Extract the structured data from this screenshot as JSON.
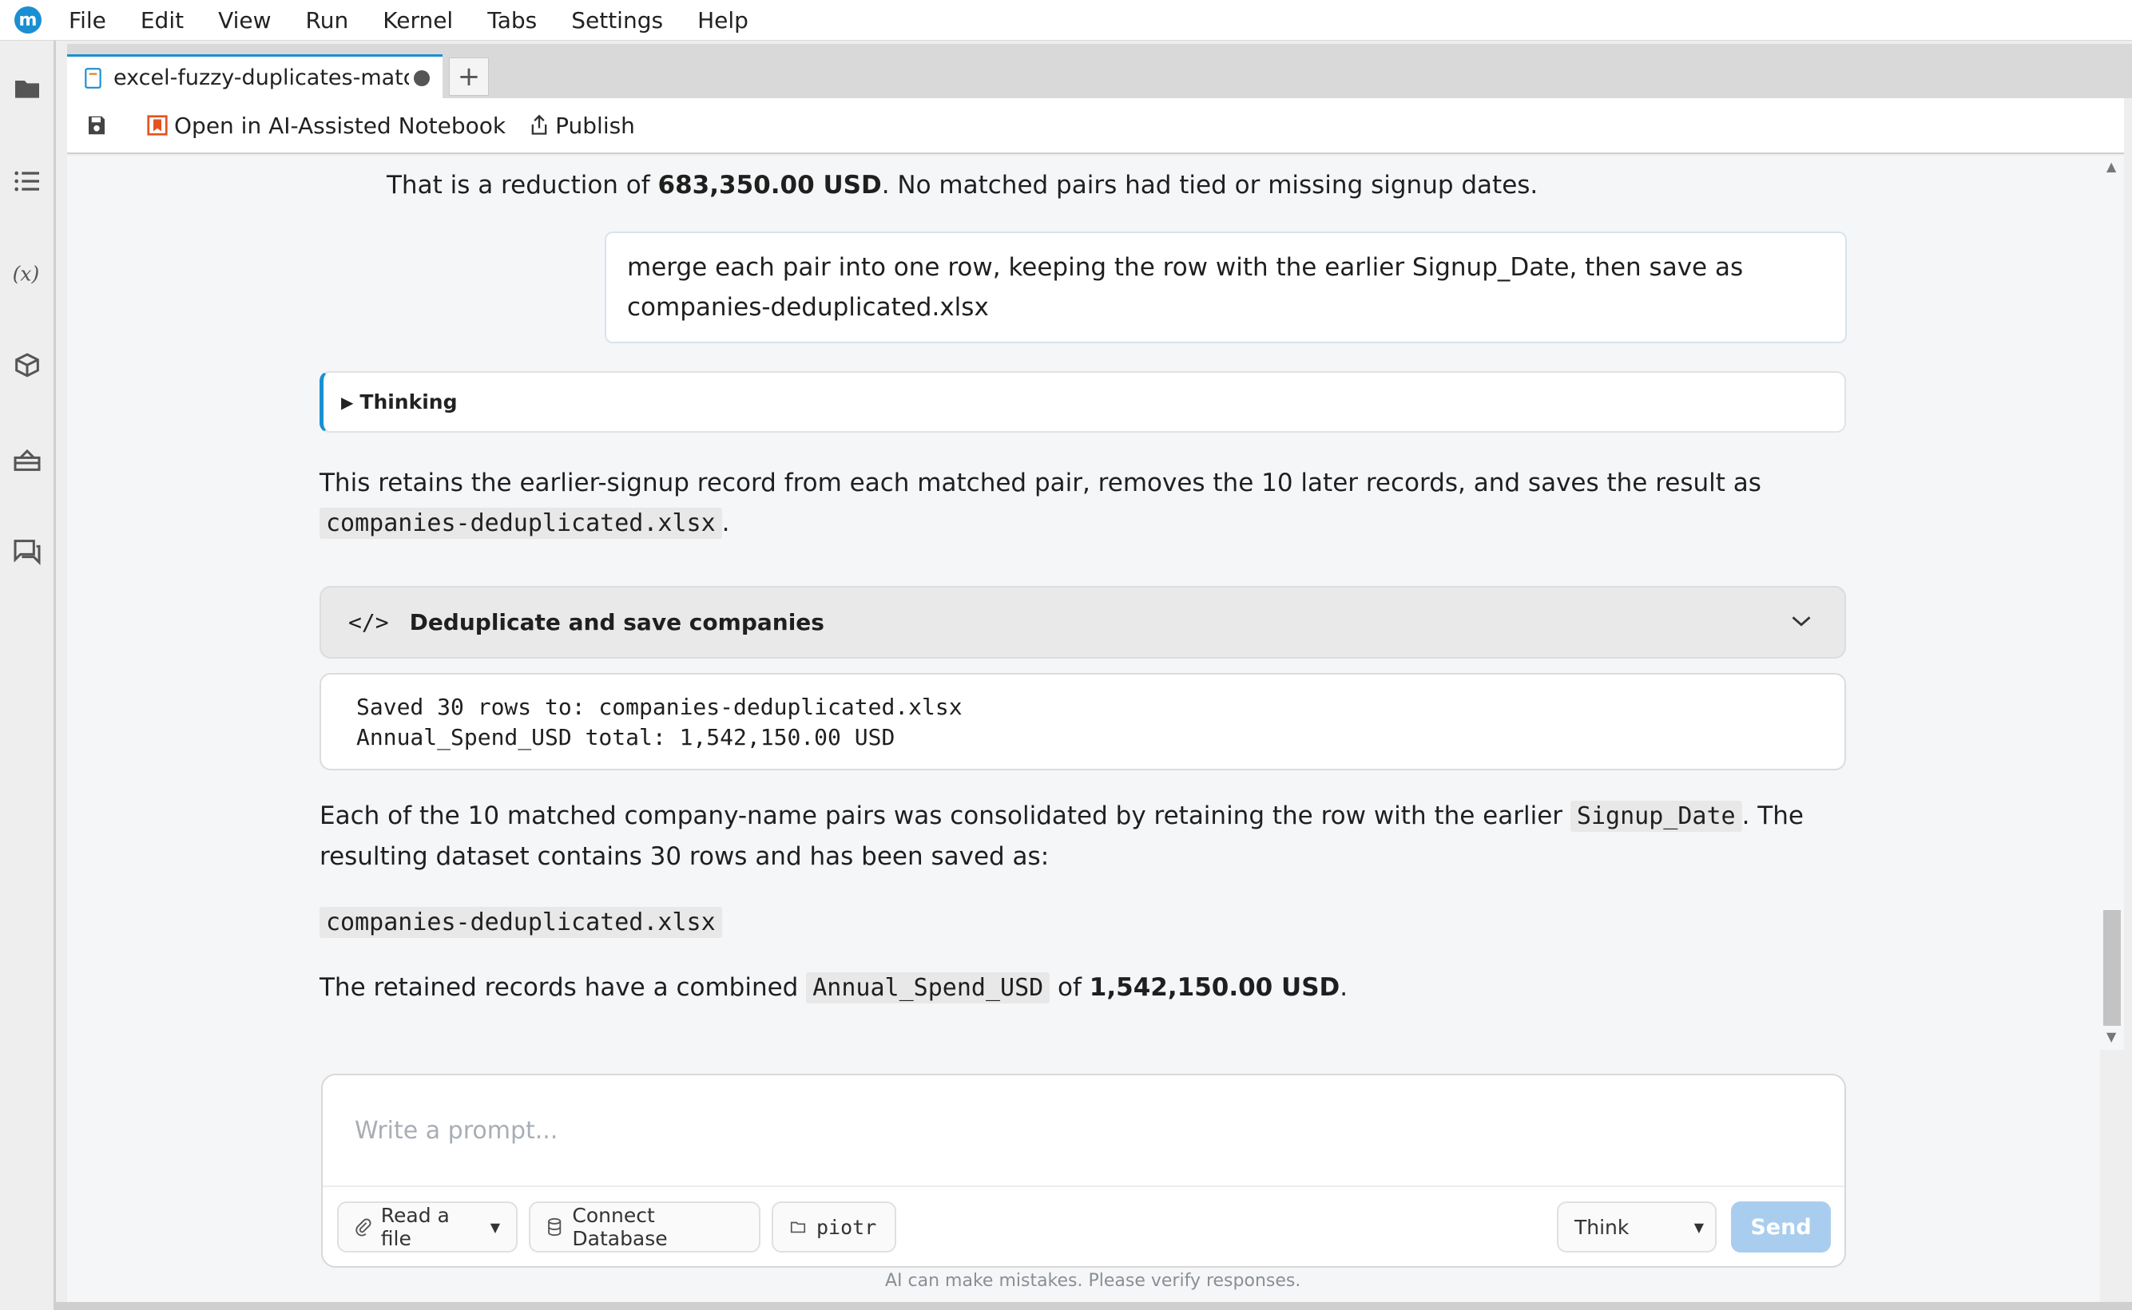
{
  "menubar": {
    "logo_letter": "m",
    "items": [
      "File",
      "Edit",
      "View",
      "Run",
      "Kernel",
      "Tabs",
      "Settings",
      "Help"
    ]
  },
  "tab": {
    "title": "excel-fuzzy-duplicates-matching.ipynb",
    "add_label": "+"
  },
  "toolbar": {
    "open_ai_label": "Open in AI-Assisted Notebook",
    "publish_label": "Publish"
  },
  "chat": {
    "intro_prefix": "That is a reduction of ",
    "intro_amount": "683,350.00 USD",
    "intro_suffix": ". No matched pairs had tied or missing signup dates.",
    "user_message": "merge each pair into one row, keeping the row with the earlier Signup_Date, then save as companies-deduplicated.xlsx",
    "thinking_label": "Thinking",
    "retains_prefix": "This retains the earlier-signup record from each matched pair, removes the 10 later records, and saves the result as ",
    "retains_file": "companies-deduplicated.xlsx",
    "retains_suffix": ".",
    "code_block_title": "Deduplicate and save companies",
    "code_icon": "</>",
    "output_line1": "Saved 30 rows to: companies-deduplicated.xlsx",
    "output_line2": "Annual_Spend_USD total: 1,542,150.00 USD",
    "summary_prefix": "Each of the 10 matched company-name pairs was consolidated by retaining the row with the earlier ",
    "summary_code": "Signup_Date",
    "summary_suffix": ". The resulting dataset contains 30 rows and has been saved as:",
    "saved_file": "companies-deduplicated.xlsx",
    "final_prefix": "The retained records have a combined ",
    "final_code": "Annual_Spend_USD",
    "final_mid": " of ",
    "final_amount": "1,542,150.00 USD",
    "final_suffix": "."
  },
  "composer": {
    "placeholder": "Write a prompt...",
    "read_file_label": "Read a file",
    "connect_db_label": "Connect Database",
    "folder_label": "piotr",
    "mode_label": "Think",
    "send_label": "Send",
    "disclaimer": "AI can make mistakes. Please verify responses."
  },
  "colors": {
    "accent": "#1a8fd1",
    "send_disabled": "#a9cdee",
    "background": "#f5f6f7"
  }
}
